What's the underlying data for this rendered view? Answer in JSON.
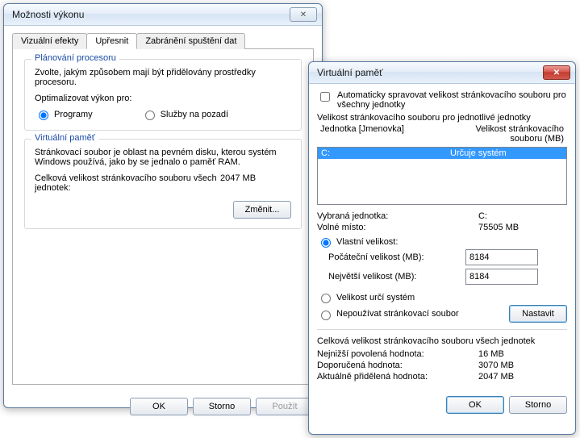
{
  "dialog1": {
    "title": "Možnosti výkonu",
    "tabs": [
      "Vizuální efekty",
      "Upřesnit",
      "Zabránění spuštění dat"
    ],
    "sched": {
      "title": "Plánování procesoru",
      "desc": "Zvolte, jakým způsobem mají být přidělovány prostředky procesoru.",
      "optimize": "Optimalizovat výkon pro:",
      "opt_programs": "Programy",
      "opt_bg": "Služby na pozadí"
    },
    "vm": {
      "title": "Virtuální paměť",
      "desc": "Stránkovací soubor je oblast na pevném disku, kterou systém Windows používá, jako by se jednalo o paměť RAM.",
      "total_label": "Celková velikost stránkovacího souboru všech jednotek:",
      "total_value": "2047 MB",
      "change": "Změnit..."
    },
    "buttons": {
      "ok": "OK",
      "cancel": "Storno",
      "apply": "Použít"
    }
  },
  "dialog2": {
    "title": "Virtuální paměť",
    "auto_label": "Automaticky spravovat velikost stránkovacího souboru pro všechny jednotky",
    "list_caption": "Velikost stránkovacího souboru pro jednotlivé jednotky",
    "list_header1": "Jednotka [Jmenovka]",
    "list_header2": "Velikost stránkovacího souboru (MB)",
    "drive_row": {
      "name": "C:",
      "val": "Určuje systém"
    },
    "selected_label": "Vybraná jednotka:",
    "selected_value": "C:",
    "free_label": "Volné místo:",
    "free_value": "75505 MB",
    "opt_custom": "Vlastní velikost:",
    "initial_label": "Počáteční velikost (MB):",
    "initial_value": "8184",
    "max_label": "Největší velikost (MB):",
    "max_value": "8184",
    "opt_system": "Velikost určí systém",
    "opt_none": "Nepoužívat stránkovací soubor",
    "set": "Nastavit",
    "total_caption": "Celková velikost stránkovacího souboru všech jednotek",
    "min_label": "Nejnižší povolená hodnota:",
    "min_value": "16 MB",
    "rec_label": "Doporučená hodnota:",
    "rec_value": "3070 MB",
    "cur_label": "Aktuálně přidělená hodnota:",
    "cur_value": "2047 MB",
    "buttons": {
      "ok": "OK",
      "cancel": "Storno"
    }
  }
}
